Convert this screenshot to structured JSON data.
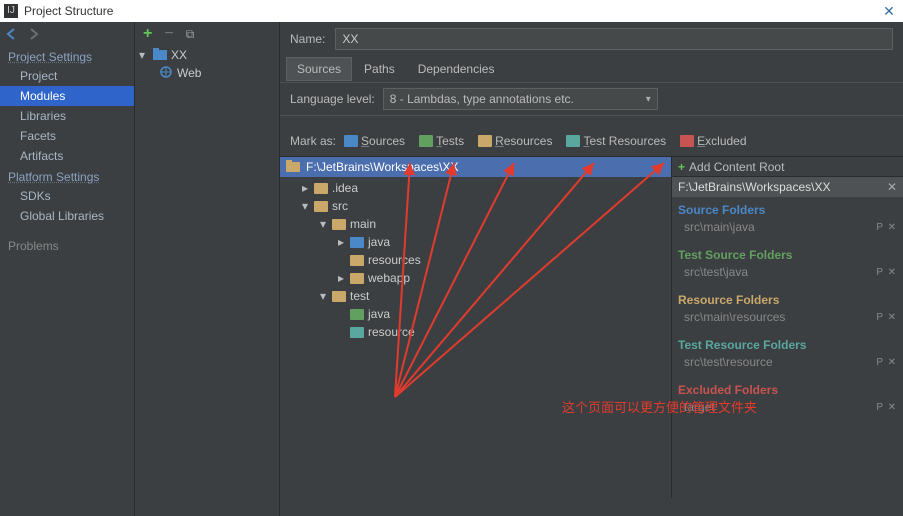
{
  "window": {
    "title": "Project Structure",
    "close": "✕"
  },
  "nav": {
    "arrows": {
      "back": "←",
      "fwd": "→"
    },
    "project_heading": "Project Settings",
    "project_items": [
      "Project",
      "Modules",
      "Libraries",
      "Facets",
      "Artifacts"
    ],
    "platform_heading": "Platform Settings",
    "platform_items": [
      "SDKs",
      "Global Libraries"
    ],
    "problems": "Problems"
  },
  "modules": {
    "toolbar": {
      "plus": "+",
      "minus": "−",
      "copy": "⧉"
    },
    "root": "XX",
    "child": "Web"
  },
  "editor": {
    "name_label": "Name:",
    "name_value": "XX",
    "tabs": [
      "Sources",
      "Paths",
      "Dependencies"
    ],
    "lang_label": "Language level:",
    "lang_value": "8 - Lambdas, type annotations etc.",
    "mark_label": "Mark as:",
    "marks": [
      {
        "label": "Sources",
        "color": "#4a88c7"
      },
      {
        "label": "Tests",
        "color": "#62a05f"
      },
      {
        "label": "Resources",
        "color": "#c9a86a"
      },
      {
        "label": "Test Resources",
        "color": "#5aa7a0"
      },
      {
        "label": "Excluded",
        "color": "#c75450"
      }
    ],
    "root_path": "F:\\JetBrains\\Workspaces\\XX",
    "tree": [
      {
        "depth": 0,
        "caret": "▸",
        "label": ".idea",
        "cls": "orange"
      },
      {
        "depth": 0,
        "caret": "▾",
        "label": "src",
        "cls": "orange"
      },
      {
        "depth": 1,
        "caret": "▾",
        "label": "main",
        "cls": "orange"
      },
      {
        "depth": 2,
        "caret": "▸",
        "label": "java",
        "cls": "blue"
      },
      {
        "depth": 2,
        "caret": "",
        "label": "resources",
        "cls": "orange"
      },
      {
        "depth": 2,
        "caret": "▸",
        "label": "webapp",
        "cls": "orange"
      },
      {
        "depth": 1,
        "caret": "▾",
        "label": "test",
        "cls": "orange"
      },
      {
        "depth": 2,
        "caret": "",
        "label": "java",
        "cls": "green"
      },
      {
        "depth": 2,
        "caret": "",
        "label": "resource",
        "cls": "teal"
      }
    ],
    "add_root": "Add Content Root",
    "content_root": "F:\\JetBrains\\Workspaces\\XX",
    "sections": [
      {
        "title": "Source Folders",
        "color": "#4a88c7",
        "entry": "src\\main\\java"
      },
      {
        "title": "Test Source Folders",
        "color": "#62a05f",
        "entry": "src\\test\\java"
      },
      {
        "title": "Resource Folders",
        "color": "#c9a86a",
        "entry": "src\\main\\resources"
      },
      {
        "title": "Test Resource Folders",
        "color": "#5aa7a0",
        "entry": "src\\test\\resource"
      },
      {
        "title": "Excluded Folders",
        "color": "#c75450",
        "entry": "target"
      }
    ]
  },
  "annotation": "这个页面可以更方便的管理文件夹"
}
